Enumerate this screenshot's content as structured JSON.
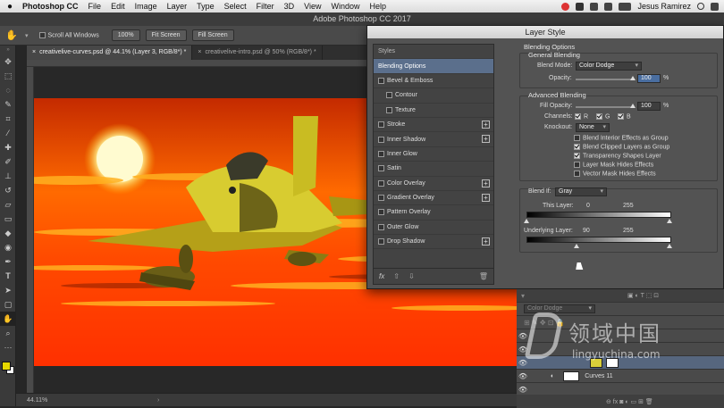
{
  "menubar": {
    "apple_icon": "apple-icon",
    "items": [
      "Photoshop CC",
      "File",
      "Edit",
      "Image",
      "Layer",
      "Type",
      "Select",
      "Filter",
      "3D",
      "View",
      "Window",
      "Help"
    ],
    "user": "Jesus Ramirez"
  },
  "window_title": "Adobe Photoshop CC 2017",
  "options_bar": {
    "scroll_all_label": "Scroll All Windows",
    "zoom_btn": "100%",
    "fit_screen": "Fit Screen",
    "fill_screen": "Fill Screen"
  },
  "tabs": [
    {
      "label": "creativelive-curves.psd @ 44.1% (Layer 3, RGB/8*) *"
    },
    {
      "label": "creativelive-intro.psd @ 50% (RGB/8*) *"
    }
  ],
  "status": {
    "zoom": "44.11%"
  },
  "dialog": {
    "title": "Layer Style",
    "styles_header": "Styles",
    "styles": [
      {
        "label": "Blending Options",
        "selected": true
      },
      {
        "label": "Bevel & Emboss",
        "plus": false
      },
      {
        "label": "Contour",
        "sub": true
      },
      {
        "label": "Texture",
        "sub": true
      },
      {
        "label": "Stroke",
        "plus": true
      },
      {
        "label": "Inner Shadow",
        "plus": true
      },
      {
        "label": "Inner Glow",
        "plus": false
      },
      {
        "label": "Satin",
        "plus": false
      },
      {
        "label": "Color Overlay",
        "plus": true
      },
      {
        "label": "Gradient Overlay",
        "plus": true
      },
      {
        "label": "Pattern Overlay",
        "plus": false
      },
      {
        "label": "Outer Glow",
        "plus": false
      },
      {
        "label": "Drop Shadow",
        "plus": true
      }
    ],
    "fx": "fx",
    "blending": {
      "section_title": "Blending Options",
      "general_title": "General Blending",
      "blend_mode_label": "Blend Mode:",
      "blend_mode_value": "Color Dodge",
      "opacity_label": "Opacity:",
      "opacity_value": "100",
      "percent": "%",
      "advanced_title": "Advanced Blending",
      "fill_opacity_label": "Fill Opacity:",
      "fill_opacity_value": "100",
      "channels_label": "Channels:",
      "channel_r": "R",
      "channel_g": "G",
      "channel_b": "B",
      "knockout_label": "Knockout:",
      "knockout_value": "None",
      "options": [
        {
          "label": "Blend Interior Effects as Group",
          "checked": false
        },
        {
          "label": "Blend Clipped Layers as Group",
          "checked": true
        },
        {
          "label": "Transparency Shapes Layer",
          "checked": true
        },
        {
          "label": "Layer Mask Hides Effects",
          "checked": false
        },
        {
          "label": "Vector Mask Hides Effects",
          "checked": false
        }
      ],
      "blend_if_label": "Blend If:",
      "blend_if_value": "Gray",
      "this_layer_label": "This Layer:",
      "this_layer_min": "0",
      "this_layer_max": "255",
      "underlying_label": "Underlying Layer:",
      "underlying_min": "90",
      "underlying_max": "255"
    }
  },
  "layers": {
    "mode_label": "Color Dodge",
    "curves_label": "Curves 11"
  },
  "watermark": {
    "cn": "领域中国",
    "url": "lingyuchina.com"
  }
}
